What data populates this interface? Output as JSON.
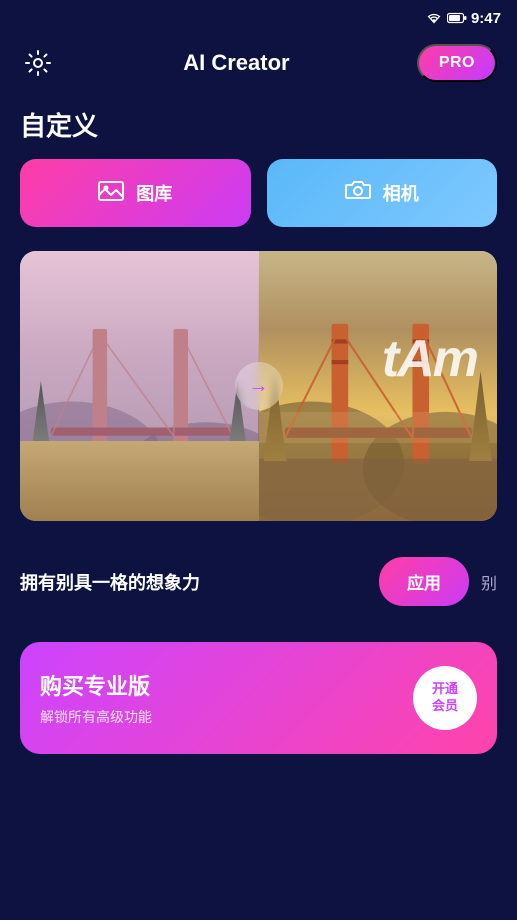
{
  "statusBar": {
    "time": "9:47"
  },
  "header": {
    "title": "AI Creator",
    "proLabel": "PRO",
    "settingsIcon": "gear-icon"
  },
  "section": {
    "title": "自定义"
  },
  "buttons": {
    "gallery": "图库",
    "camera": "相机"
  },
  "carousel": {
    "tamText": "tAm",
    "arrowIcon": "→"
  },
  "bottomBar": {
    "text": "拥有别具一格的想象力",
    "applyLabel": "应用",
    "moreLabel": "别"
  },
  "purchaseCard": {
    "title": "购买专业版",
    "subtitle": "解锁所有高级功能",
    "unlockLine1": "开通",
    "unlockLine2": "会员"
  }
}
